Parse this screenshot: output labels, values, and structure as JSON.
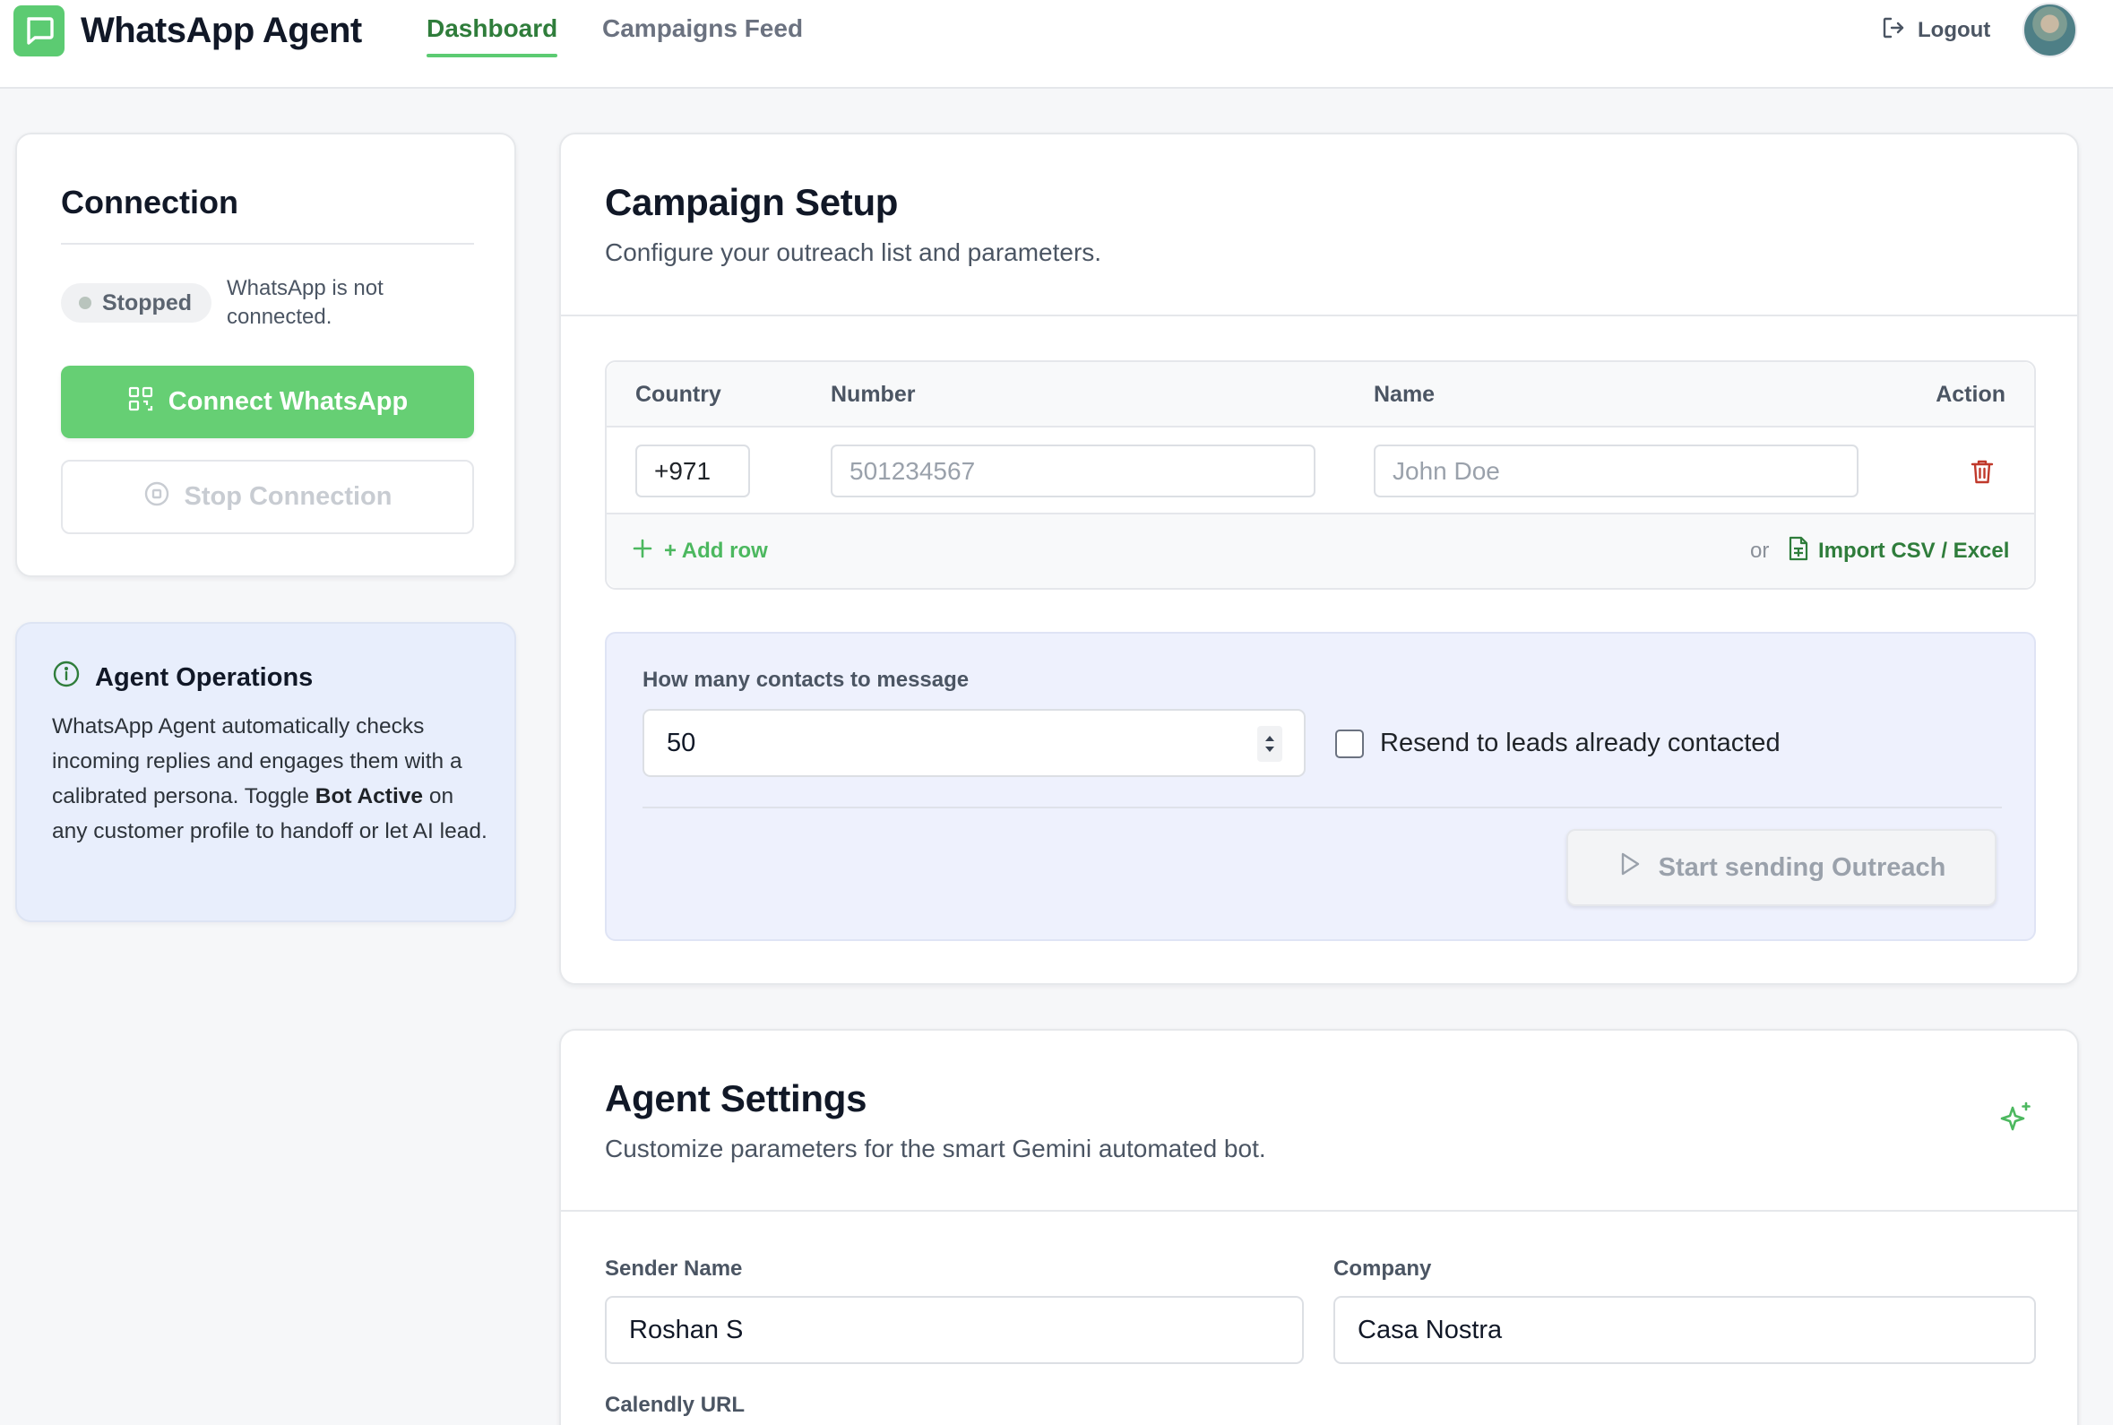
{
  "app": {
    "name": "WhatsApp Agent"
  },
  "nav": {
    "tabs": [
      {
        "label": "Dashboard",
        "active": true
      },
      {
        "label": "Campaigns Feed",
        "active": false
      }
    ],
    "logout_label": "Logout"
  },
  "connection": {
    "title": "Connection",
    "status_badge": "Stopped",
    "status_text": "WhatsApp is not connected.",
    "connect_button": "Connect WhatsApp",
    "stop_button": "Stop Connection"
  },
  "agent_operations": {
    "title": "Agent Operations",
    "text_before": "WhatsApp Agent automatically checks incoming replies and engages them with a calibrated persona. Toggle ",
    "text_bold": "Bot Active",
    "text_after": " on any customer profile to handoff or let AI lead."
  },
  "campaign_setup": {
    "title": "Campaign Setup",
    "subtitle": "Configure your outreach list and parameters.",
    "table": {
      "headers": {
        "country": "Country",
        "number": "Number",
        "name": "Name",
        "action": "Action"
      },
      "rows": [
        {
          "country": "+971",
          "number_placeholder": "501234567",
          "name_placeholder": "John Doe"
        }
      ]
    },
    "add_row_label": "+ Add row",
    "or_label": "or",
    "import_label": "Import CSV / Excel",
    "contacts_count_label": "How many contacts to message",
    "contacts_count_value": "50",
    "resend_label": "Resend to leads already contacted",
    "resend_checked": false,
    "start_button": "Start sending Outreach"
  },
  "agent_settings": {
    "title": "Agent Settings",
    "subtitle": "Customize parameters for the smart Gemini automated bot.",
    "sender_name_label": "Sender Name",
    "sender_name_value": "Roshan S",
    "company_label": "Company",
    "company_value": "Casa Nostra",
    "calendly_label": "Calendly URL"
  },
  "colors": {
    "brand_green": "#5ccb72",
    "accent_dark_green": "#2f7d3b",
    "danger_red": "#c0392b",
    "ops_panel": "#e8eefc"
  },
  "icons": [
    "chat-bubble-icon",
    "logout-icon",
    "qr-code-icon",
    "stop-circle-icon",
    "info-icon",
    "trash-icon",
    "plus-icon",
    "file-spreadsheet-icon",
    "play-icon",
    "sparkles-icon"
  ]
}
